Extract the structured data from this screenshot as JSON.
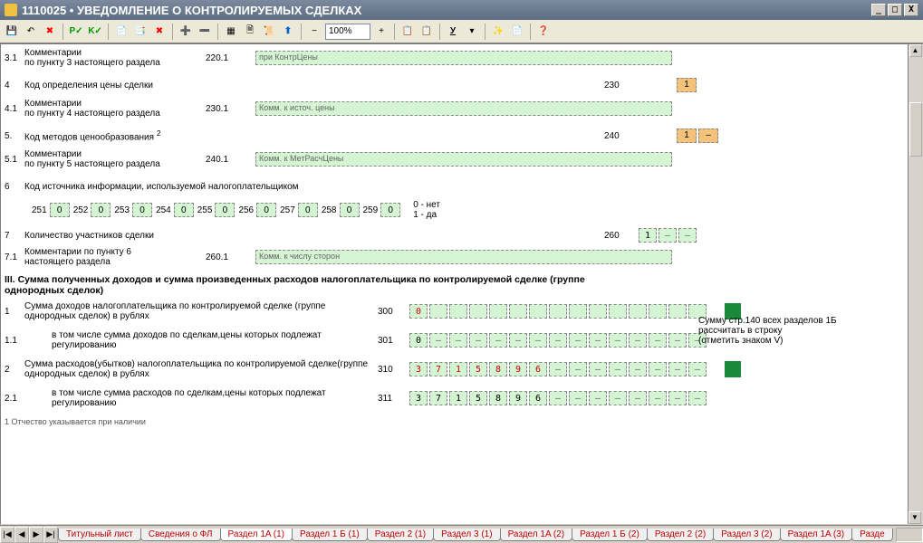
{
  "window": {
    "title": "1110025 • УВЕДОМЛЕНИЕ О КОНТРОЛИРУЕМЫХ СДЕЛКАХ",
    "min": "_",
    "max": "□",
    "close": "X"
  },
  "toolbar": {
    "zoom": "100%"
  },
  "rows": {
    "r31": {
      "num": "3.1",
      "label": "Комментарии\nпо пункту 3 настоящего раздела",
      "code": "220.1",
      "ph": "при КонтрЦены"
    },
    "r4": {
      "num": "4",
      "label": "Код определения цены сделки",
      "code": "230",
      "val": "1"
    },
    "r41": {
      "num": "4.1",
      "label": "Комментарии\nпо пункту 4 настоящего раздела",
      "code": "230.1",
      "ph": "Комм. к источ. цены"
    },
    "r5": {
      "num": "5.",
      "label": "Код методов ценообразования",
      "sup": "2",
      "code": "240",
      "val": "1",
      "val2": "–"
    },
    "r51": {
      "num": "5.1",
      "label": "Комментарии\nпо пункту 5 настоящего раздела",
      "code": "240.1",
      "ph": "Комм. к МетРасчЦены"
    },
    "r6": {
      "num": "6",
      "label": "Код источника информации, используемой налогоплательщиком"
    },
    "r6cells": [
      {
        "c": "251",
        "v": "0"
      },
      {
        "c": "252",
        "v": "0"
      },
      {
        "c": "253",
        "v": "0"
      },
      {
        "c": "254",
        "v": "0"
      },
      {
        "c": "255",
        "v": "0"
      },
      {
        "c": "256",
        "v": "0"
      },
      {
        "c": "257",
        "v": "0"
      },
      {
        "c": "258",
        "v": "0"
      },
      {
        "c": "259",
        "v": "0"
      }
    ],
    "r6legend": "0 - нет\n1 - да",
    "r7": {
      "num": "7",
      "label": "Количество участников сделки",
      "code": "260",
      "vals": [
        "1",
        "–",
        "–"
      ]
    },
    "r71": {
      "num": "7.1",
      "label": "Комментарии по пункту 6\nнастоящего раздела",
      "code": "260.1",
      "ph": "Комм. к числу сторон"
    }
  },
  "section3": {
    "header": "III. Сумма полученных доходов и сумма произведенных расходов налогоплательщика по контролируемой сделке (группе однородных сделок)",
    "right_note1": "Сумму стр.140 всех разделов 1Б рассчитать в строку",
    "right_note2": "(отметить знаком V)",
    "r1": {
      "num": "1",
      "label": "Сумма доходов налогоплательщика по контролируемой сделке (группе однородных сделок) в рублях",
      "code": "300",
      "vals": [
        "0",
        "",
        "",
        "",
        "",
        "",
        "",
        "",
        "",
        "",
        "",
        "",
        "",
        "",
        ""
      ]
    },
    "r11": {
      "num": "1.1",
      "label": "в том числе сумма доходов по сделкам,цены которых подлежат регулированию",
      "code": "301",
      "vals": [
        "0",
        "–",
        "–",
        "–",
        "–",
        "–",
        "–",
        "–",
        "–",
        "–",
        "–",
        "–",
        "–",
        "–",
        "–"
      ]
    },
    "r2": {
      "num": "2",
      "label": "Сумма расходов(убытков) налогоплательщика по контролируемой сделке(группе однородных сделок) в рублях",
      "code": "310",
      "vals": [
        "3",
        "7",
        "1",
        "5",
        "8",
        "9",
        "6",
        "–",
        "–",
        "–",
        "–",
        "–",
        "–",
        "–",
        "–"
      ]
    },
    "r21": {
      "num": "2.1",
      "label": "в том числе сумма расходов по сделкам,цены которых подлежат регулированию",
      "code": "311",
      "vals": [
        "3",
        "7",
        "1",
        "5",
        "8",
        "9",
        "6",
        "–",
        "–",
        "–",
        "–",
        "–",
        "–",
        "–",
        "–"
      ]
    }
  },
  "footnote": "1 Отчество указывается при наличии",
  "tabs": {
    "nav": [
      "|◀",
      "◀",
      "▶",
      "▶|"
    ],
    "items": [
      "Титульный лист",
      "Сведения о ФЛ",
      "Раздел 1A (1)",
      "Раздел 1 Б (1)",
      "Раздел 2 (1)",
      "Раздел 3 (1)",
      "Раздел 1A (2)",
      "Раздел 1 Б (2)",
      "Раздел 2 (2)",
      "Раздел 3 (2)",
      "Раздел 1A (3)",
      "Разде"
    ],
    "active": 2
  }
}
